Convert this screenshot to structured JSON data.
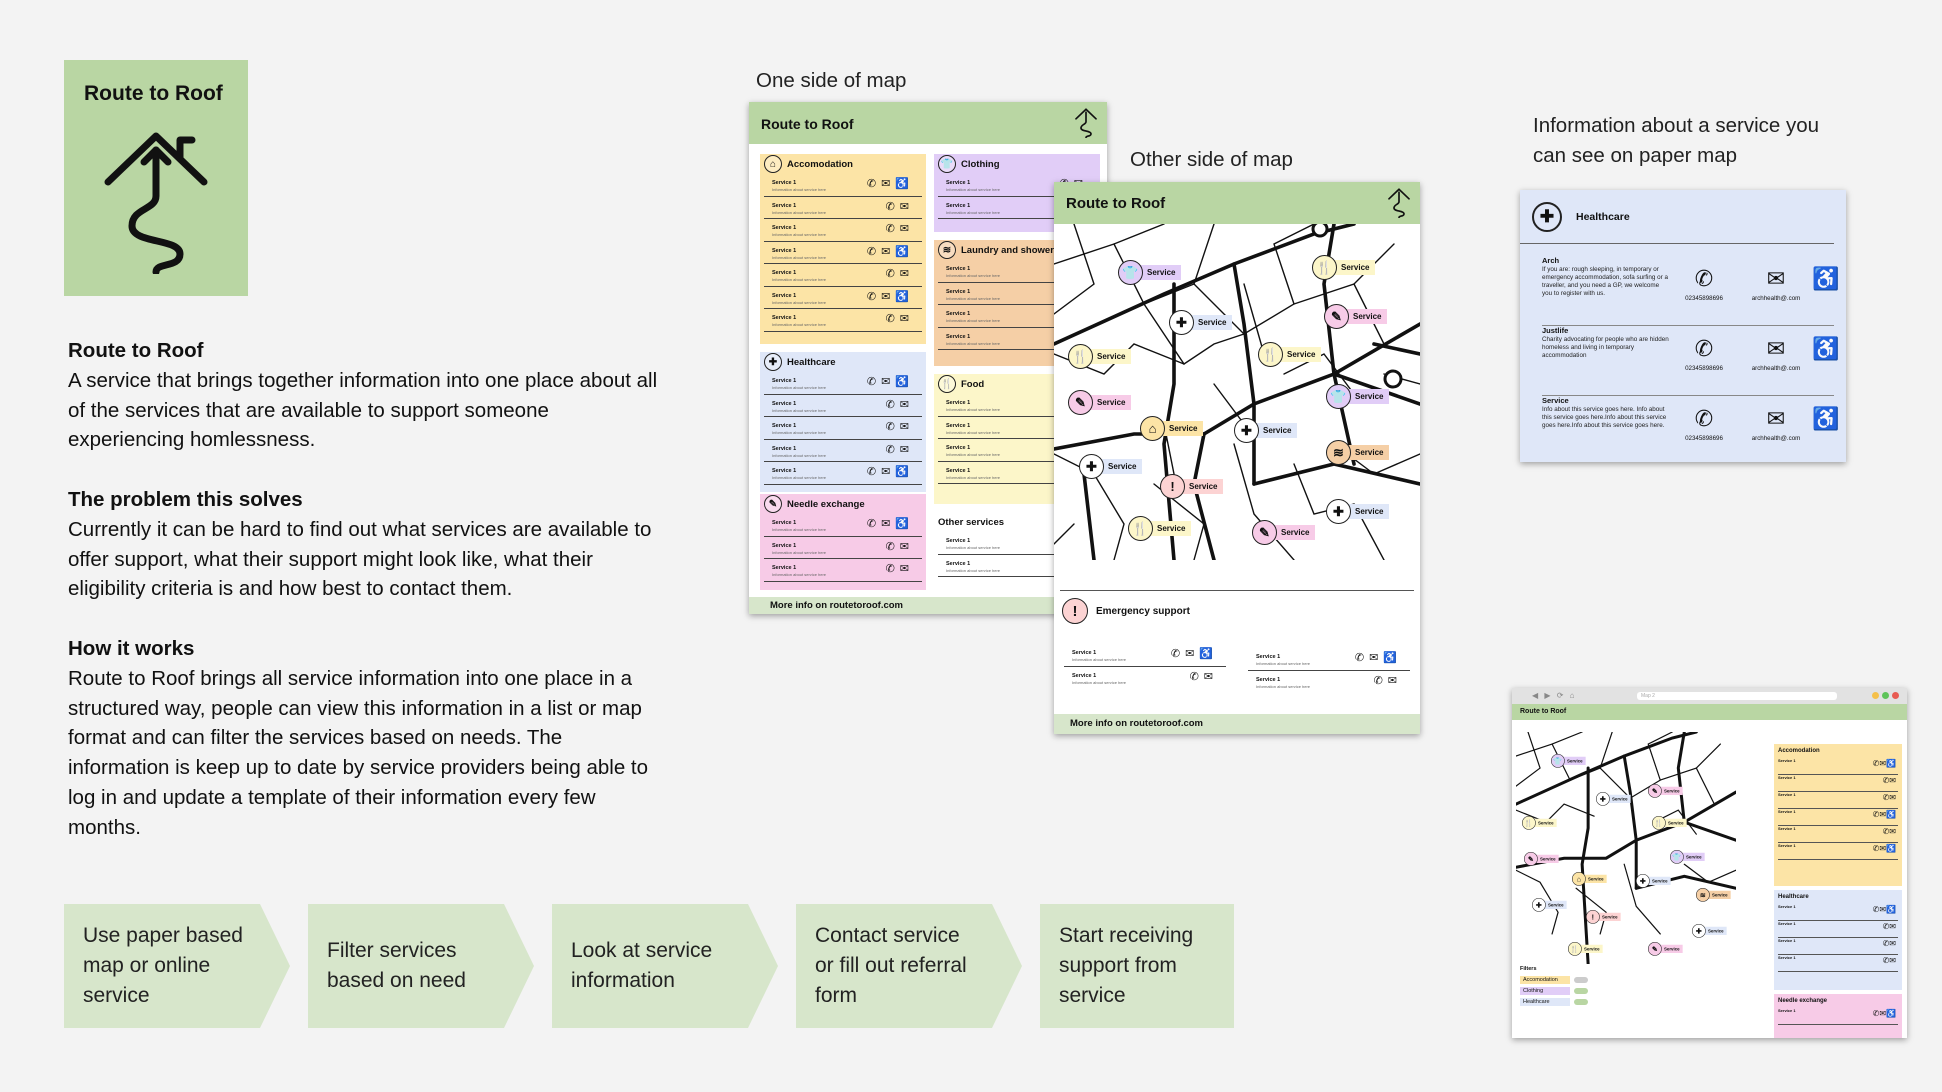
{
  "brand": {
    "title": "Route to Roof"
  },
  "description": {
    "heading": "Route to Roof",
    "intro": "A service that brings together information into one place about all of the services that are available to support someone experiencing homlessness.",
    "problem_heading": "The problem this solves",
    "problem_text": "Currently it can be hard to find out what services are available to offer support, what their support might look like, what their eligibility criteria is and how best to contact them.",
    "how_heading": "How it works",
    "how_text": "Route to Roof brings all service information into one place in a structured way, people can view this information in a list or map format and can filter the services based on needs. The information is keep up to date by service providers being able to log in and update a template of their information every few months."
  },
  "steps": [
    "Use paper based map or online service",
    "Filter services based on need",
    "Look at service information",
    "Contact service or fill out referral form",
    "Start receiving support from service"
  ],
  "captions": {
    "side_one": "One side of map",
    "side_two": "Other side of map",
    "info": "Information about a service you can see on paper map"
  },
  "paper_map_front": {
    "title": "Route to Roof",
    "footer": "More info on routetoroof.com",
    "sections": {
      "accomodation": "Accomodation",
      "clothing": "Clothing",
      "laundry": "Laundry and showers",
      "healthcare": "Healthcare",
      "food": "Food",
      "needle": "Needle exchange",
      "other": "Other services"
    },
    "row_name": "Service 1",
    "row_info": "Information about service here"
  },
  "paper_map_back": {
    "title": "Route to Roof",
    "footer": "More info on routetoroof.com",
    "pin_label": "Service",
    "emergency": "Emergency support",
    "row_name": "Service 1",
    "row_info": "Information about service here"
  },
  "info_card": {
    "category": "Healthcare",
    "services": [
      {
        "name": "Arch",
        "desc": "If you are: rough sleeping, in temporary or emergency accommodation, sofa surfing or a traveller, and you need a GP, we welcome you to register with us.",
        "phone": "02345898696",
        "email": "archhealth@.com"
      },
      {
        "name": "Justlife",
        "desc": "Charity advocating for people who are hidden homeless and living in temporary accommodation",
        "phone": "02345898696",
        "email": "archhealth@.com"
      },
      {
        "name": "Service",
        "desc": "Info about this service goes here. Info about this service goes here.Info about this service goes here.Info about this service goes here.",
        "phone": "02345898696",
        "email": "archhealth@.com"
      }
    ]
  },
  "browser": {
    "title": "Route to Roof",
    "url": "Map 2",
    "filters_label": "Filters",
    "filters": [
      "Accomodation",
      "Clothing",
      "Healthcare"
    ],
    "sections": {
      "accomodation": "Accomodation",
      "healthcare": "Healthcare",
      "needle": "Needle exchange"
    },
    "pin_label": "Service",
    "row_name": "Service 1"
  },
  "colors": {
    "brand_green": "#b9d6a3",
    "step_green": "#d7e6cb",
    "accomodation": "#fce4a6",
    "clothing": "#e1cdf7",
    "laundry": "#f5cfa6",
    "healthcare": "#dfe7f8",
    "food": "#fcf6c9",
    "needle": "#f7cbe7",
    "emergency": "#fcd3d3"
  }
}
